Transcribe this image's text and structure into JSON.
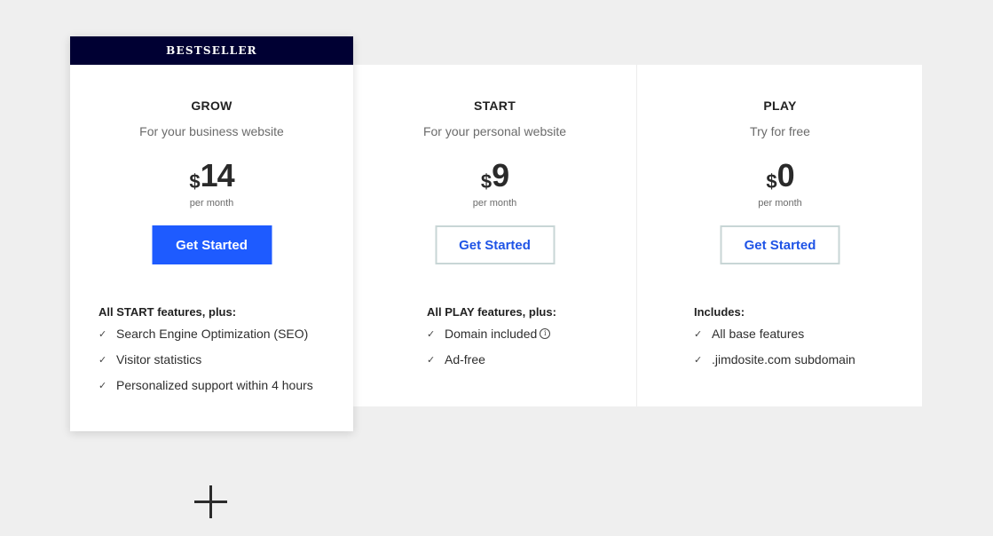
{
  "plans": [
    {
      "id": "grow",
      "badge": "BESTSELLER",
      "name": "GROW",
      "tagline": "For your business website",
      "currency": "$",
      "price": "14",
      "period": "per month",
      "cta_label": "Get Started",
      "features_heading": "All START features, plus:",
      "features": [
        "Search Engine Optimization (SEO)",
        "Visitor statistics",
        "Personalized support within 4 hours"
      ]
    },
    {
      "id": "start",
      "name": "START",
      "tagline": "For your personal website",
      "currency": "$",
      "price": "9",
      "period": "per month",
      "cta_label": "Get Started",
      "features_heading": "All PLAY features, plus:",
      "features": [
        "Domain included",
        "Ad-free"
      ]
    },
    {
      "id": "play",
      "name": "PLAY",
      "tagline": "Try for free",
      "currency": "$",
      "price": "0",
      "period": "per month",
      "cta_label": "Get Started",
      "features_heading": "Includes:",
      "features": [
        "All base features",
        ".jimdosite.com subdomain"
      ]
    }
  ],
  "icons": {
    "check": "check-icon",
    "info": "info-icon",
    "expand": "plus-icon"
  },
  "colors": {
    "primary_button": "#1e5bff",
    "badge_background": "#000033",
    "page_background": "#efefef"
  }
}
